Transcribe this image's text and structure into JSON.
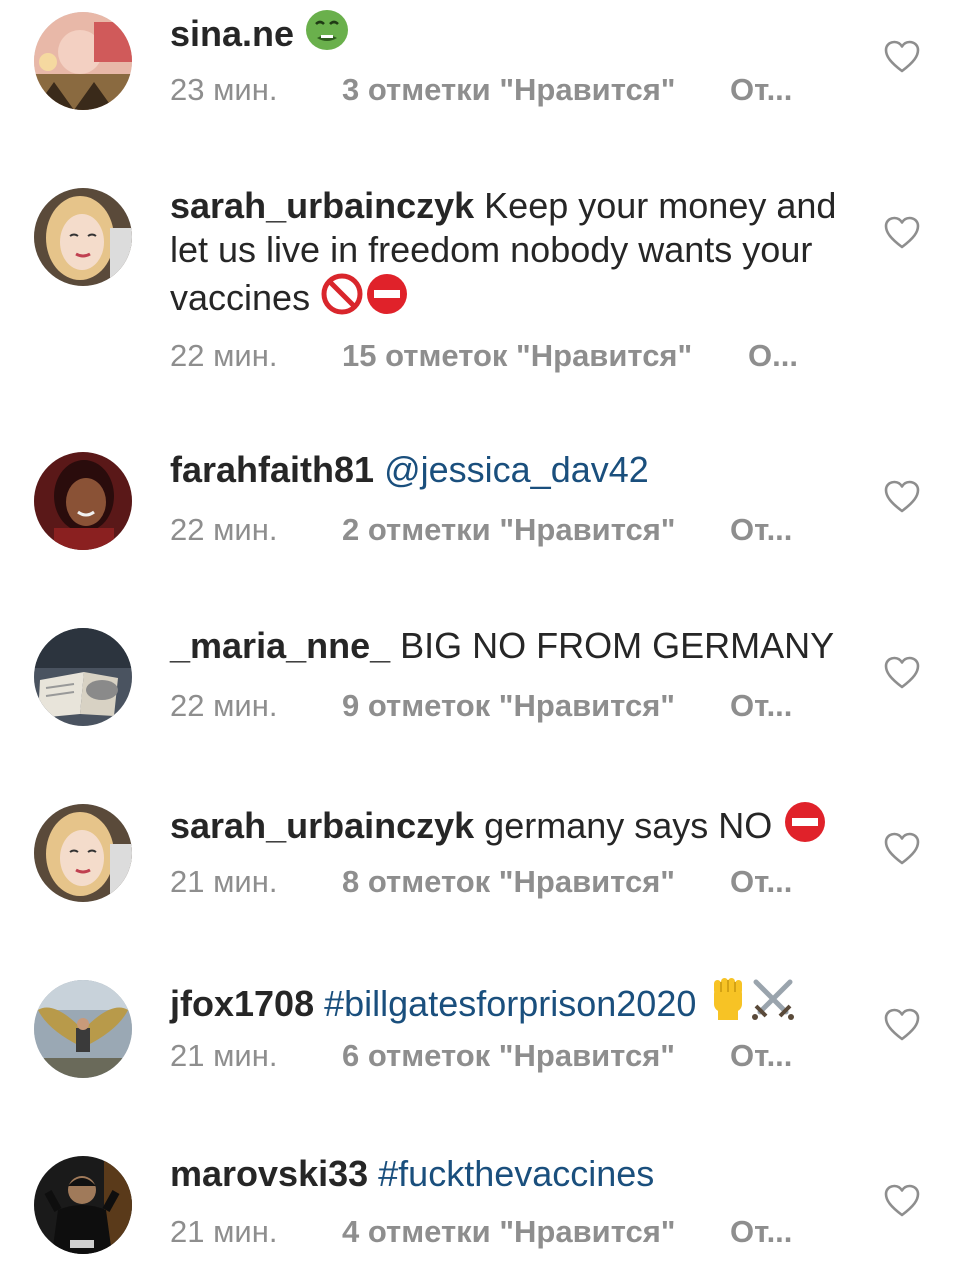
{
  "comments": [
    {
      "username": "sina.ne",
      "text": "",
      "emoji": [
        "nauseated-face-icon"
      ],
      "time": "23 мин.",
      "likes": "3 отметки \"Нравится\"",
      "reply": "От..."
    },
    {
      "username": "sarah_urbainczyk",
      "text": "Keep your money and let us live in freedom nobody wants your vaccines",
      "emoji": [
        "prohibited-icon",
        "no-entry-icon"
      ],
      "time": "22 мин.",
      "likes": "15 отметок \"Нравится\"",
      "reply": "О..."
    },
    {
      "username": "farahfaith81",
      "mention": "@jessica_dav42",
      "time": "22 мин.",
      "likes": "2 отметки \"Нравится\"",
      "reply": "От..."
    },
    {
      "username": "_maria_nne_",
      "text": "BIG NO FROM GERMANY",
      "time": "22 мин.",
      "likes": "9 отметок \"Нравится\"",
      "reply": "От..."
    },
    {
      "username": "sarah_urbainczyk",
      "text": "germany says NO",
      "emoji": [
        "no-entry-icon"
      ],
      "time": "21 мин.",
      "likes": "8 отметок \"Нравится\"",
      "reply": "От..."
    },
    {
      "username": "jfox1708",
      "hashtag": "#billgatesforprison2020",
      "emoji": [
        "raised-fist-icon",
        "crossed-swords-icon"
      ],
      "time": "21 мин.",
      "likes": "6 отметок \"Нравится\"",
      "reply": "От..."
    },
    {
      "username": "marovski33",
      "hashtag": "#fuckthevaccines",
      "time": "21 мин.",
      "likes": "4 отметки \"Нравится\"",
      "reply": "От..."
    }
  ],
  "icons": {
    "like": "heart-outline-icon"
  },
  "colors": {
    "text": "#262626",
    "meta": "#8e8e8e",
    "link": "#1a4f7d"
  }
}
